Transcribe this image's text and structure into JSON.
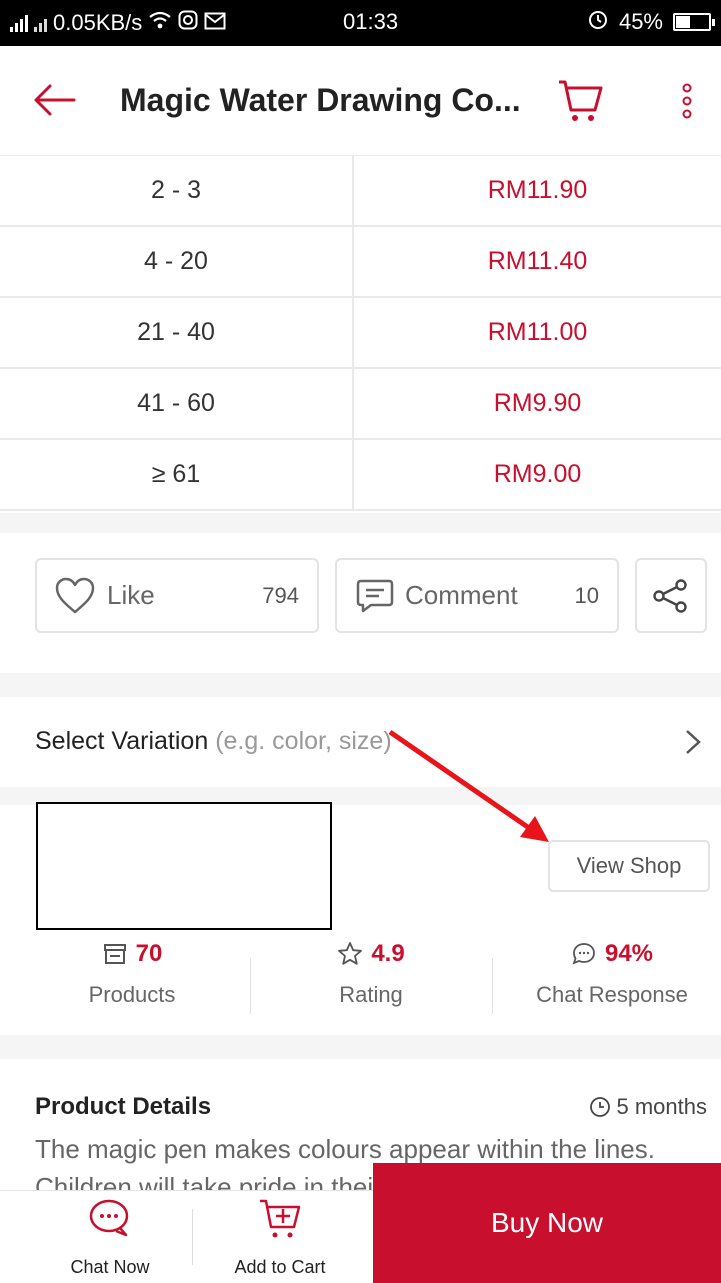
{
  "status_bar": {
    "network": "0.05KB/s",
    "time": "01:33",
    "battery": "45%",
    "battery_level": 0.45
  },
  "header": {
    "title": "Magic Water Drawing Co..."
  },
  "price_table": [
    {
      "qty": "2 - 3",
      "price": "RM11.90"
    },
    {
      "qty": "4 - 20",
      "price": "RM11.40"
    },
    {
      "qty": "21 - 40",
      "price": "RM11.00"
    },
    {
      "qty": "41 - 60",
      "price": "RM9.90"
    },
    {
      "qty": "≥ 61",
      "price": "RM9.00"
    }
  ],
  "actions": {
    "like_label": "Like",
    "like_count": "794",
    "comment_label": "Comment",
    "comment_count": "10"
  },
  "variation": {
    "label": "Select Variation",
    "hint": "(e.g. color, size)"
  },
  "shop": {
    "view_shop_label": "View Shop",
    "products_value": "70",
    "products_label": "Products",
    "rating_value": "4.9",
    "rating_label": "Rating",
    "chat_value": "94%",
    "chat_label": "Chat Response"
  },
  "details": {
    "title": "Product Details",
    "age": "5 months",
    "description": "The magic pen makes colours appear within the lines. Children will take pride in their colouring. A good"
  },
  "bottom_bar": {
    "chat_label": "Chat Now",
    "cart_label": "Add to Cart",
    "buy_label": "Buy Now"
  },
  "colors": {
    "accent": "#c8102e",
    "annotation_arrow": "#e8141a"
  }
}
